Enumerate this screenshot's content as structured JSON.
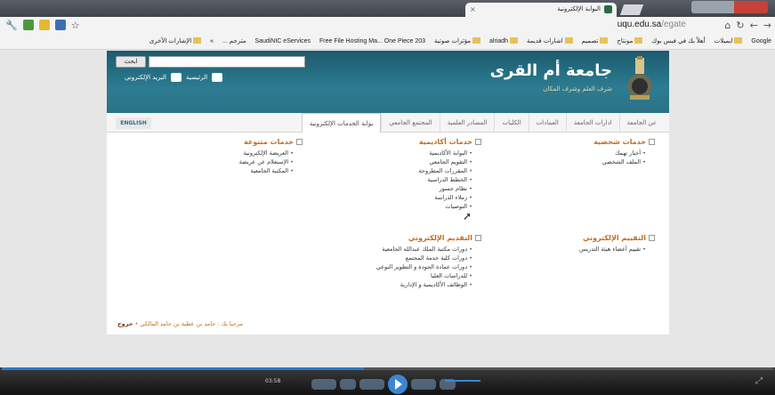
{
  "browser": {
    "tab_title": "البوابة الإلكترونية",
    "url_host": "uqu.edu.sa",
    "url_path": "/egate",
    "bookmarks": [
      "Google",
      "ايميلات",
      "أهلاً بك في فيس بوك",
      "مونتاج",
      "تصميم",
      "اشارات قديمة",
      "alriadh",
      "مؤثرات صوتية",
      "SaudiNIC eServices",
      "Free File Hosting Ma...",
      "One Piece 203 مترجم ...",
      "»",
      "الإشارات الأخرى"
    ]
  },
  "header": {
    "search_button": "ابحث",
    "title": "جامعة أم القرى",
    "subtitle": "شرف العلم وشرف المكان",
    "links": {
      "home": "الرئيسية",
      "email": "البريد الإلكتروني"
    }
  },
  "menu": {
    "lang": "ENGLISH",
    "items": [
      "عن الجامعة",
      "ادارات الجامعة",
      "العمادات",
      "الكليات",
      "المصادر العلمية",
      "المجتمع الجامعي",
      "بوابة الخدمات الإلكترونية"
    ]
  },
  "panel": {
    "personal": {
      "title": "خدمات شخصية",
      "items": [
        "أخبار تهمك",
        "الملف الشخصي"
      ]
    },
    "academic": {
      "title": "خدمات أكاديمية",
      "items": [
        "البوابة الأكاديمية",
        "التقويم الجامعي",
        "المقررات المطروحة",
        "الخطط الدراسية",
        "نظام جسور",
        "زملاء الدراسة",
        "التوصيات"
      ]
    },
    "misc": {
      "title": "خدمات متنوعة",
      "items": [
        "العريضة الإلكترونية",
        "الإستعلام عن عريضة",
        "المكتبة الجامعية"
      ]
    },
    "eval": {
      "title": "التقييم الإلكتروني",
      "items": [
        "تقييم أعضاء هيئة التدريس"
      ]
    },
    "apply": {
      "title": "التقديم الإلكتروني",
      "items": [
        "دورات مكتبة الملك عبدالله الجامعية",
        "دورات كلية خدمة المجتمع",
        "دورات عمادة الجودة و التطوير النوعي",
        "للدراسات العليا",
        "الوظائف الأكاديمية و الإدارية"
      ]
    },
    "welcome_label": "مرحبا بك : حامد بن عطية بن حامد المالكي",
    "exit": "خروج"
  },
  "video": {
    "time": "03:58",
    "progress": 0.47
  }
}
